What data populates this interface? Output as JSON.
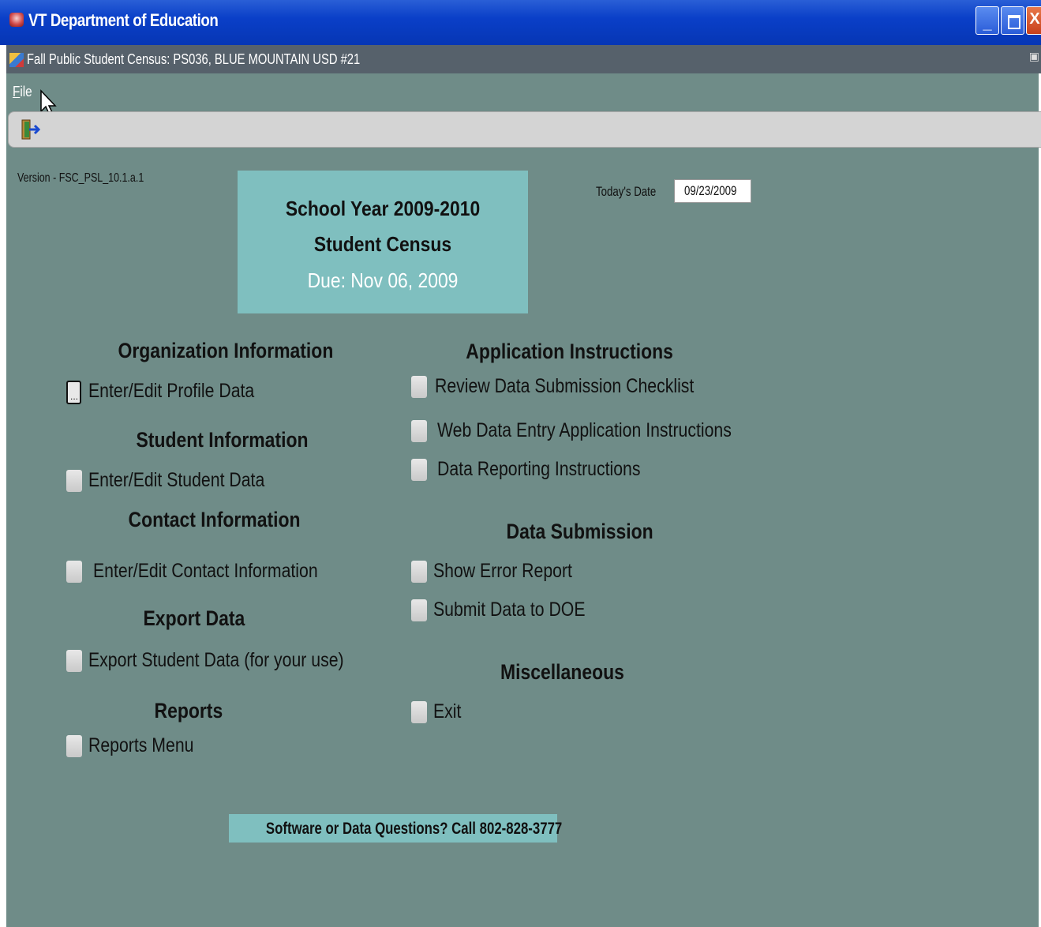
{
  "window": {
    "title": "VT Department of Education"
  },
  "form": {
    "title": "Fall Public Student Census:  PS036, BLUE MOUNTAIN USD #21"
  },
  "menu": {
    "file": "File"
  },
  "version": "Version - FSC_PSL_10.1.a.1",
  "header_box": {
    "line1": "School Year 2009-2010",
    "line2": "Student Census",
    "line3": "Due:  Nov 06, 2009"
  },
  "today": {
    "label": "Today's Date",
    "value": "09/23/2009"
  },
  "sections_left": {
    "org": {
      "heading": "Organization Information",
      "option": "Enter/Edit Profile Data"
    },
    "student": {
      "heading": "Student Information",
      "option": "Enter/Edit Student Data"
    },
    "contact": {
      "heading": "Contact Information",
      "option": "Enter/Edit Contact Information"
    },
    "export": {
      "heading": "Export Data",
      "option": "Export Student Data (for your use)"
    },
    "reports": {
      "heading": "Reports",
      "option": "Reports Menu"
    }
  },
  "sections_right": {
    "instructions": {
      "heading": "Application Instructions",
      "options": [
        "Review Data Submission Checklist",
        "Web Data Entry Application Instructions",
        "Data Reporting Instructions"
      ]
    },
    "submission": {
      "heading": "Data Submission",
      "options": [
        "Show Error Report",
        "Submit Data to DOE"
      ]
    },
    "misc": {
      "heading": "Miscellaneous",
      "option": "Exit"
    }
  },
  "help": "Software or Data Questions?  Call 802-828-3777",
  "colors": {
    "titlebar": "#0a3fc8",
    "background": "#6f8c88",
    "header_box": "#7fbfbf",
    "subbar": "#56616b"
  },
  "icons": [
    "app-icon",
    "form-icon",
    "exit-door-icon",
    "mouse-cursor-icon",
    "minimize-icon",
    "maximize-icon",
    "close-icon"
  ]
}
